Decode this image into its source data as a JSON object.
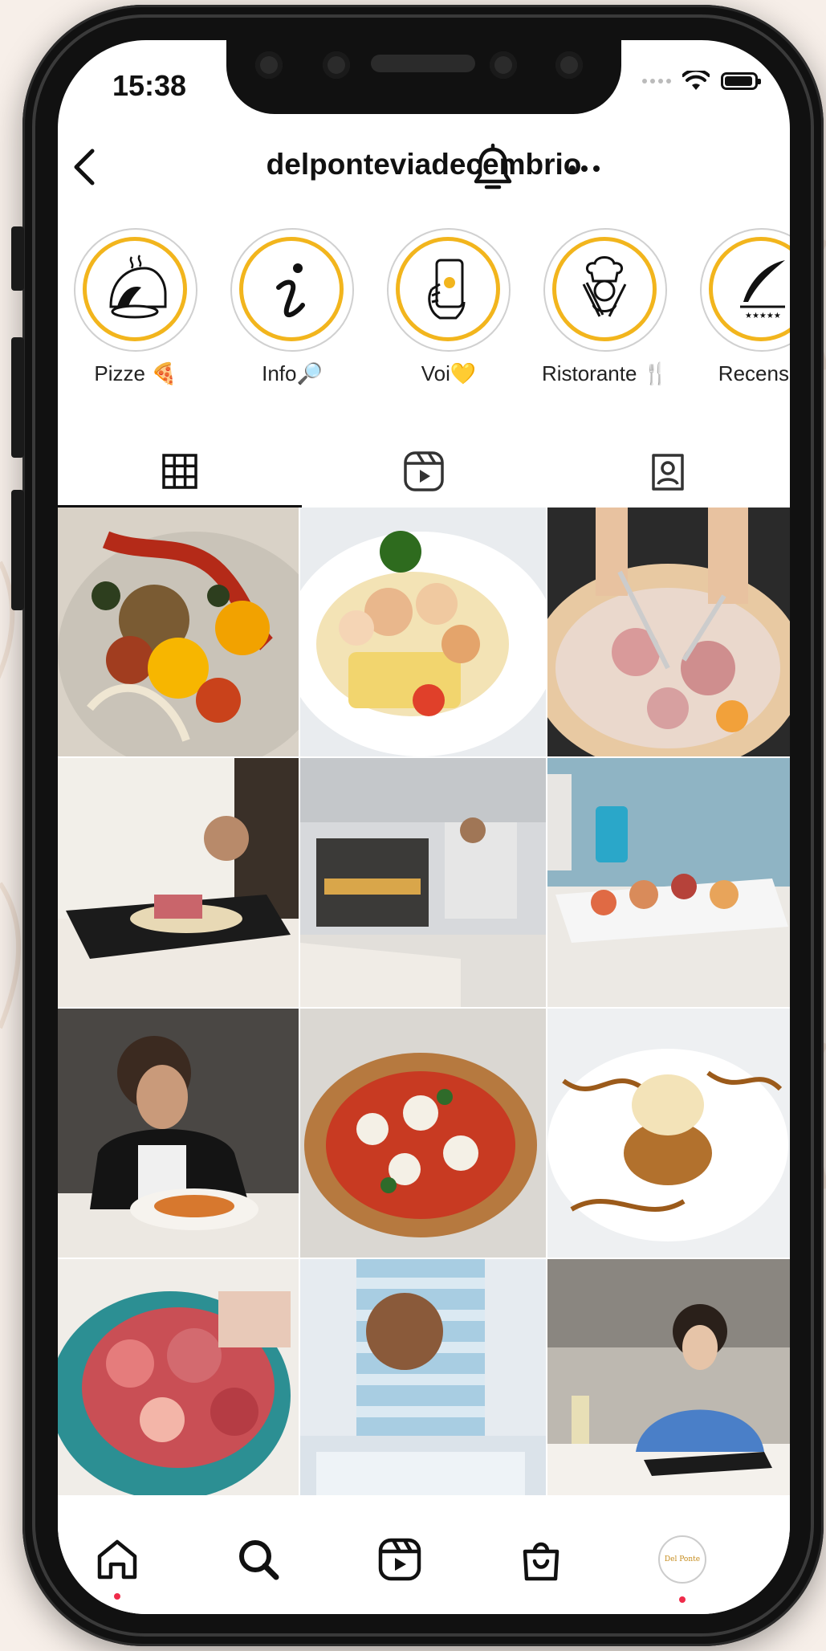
{
  "status_bar": {
    "time": "15:38"
  },
  "header": {
    "username": "delponteviadecembrio"
  },
  "highlights": [
    {
      "label": "Pizze 🍕",
      "icon": "pizza-oven-icon"
    },
    {
      "label": "Info🔎",
      "icon": "info-icon"
    },
    {
      "label": "Voi💛",
      "icon": "phone-hand-icon"
    },
    {
      "label": "Ristorante 🍴",
      "icon": "chef-icon"
    },
    {
      "label": "Recensio",
      "icon": "quill-icon"
    }
  ],
  "tabs": [
    {
      "name": "posts-grid",
      "icon": "grid-icon",
      "active": true
    },
    {
      "name": "reels",
      "icon": "reels-icon",
      "active": false
    },
    {
      "name": "tagged",
      "icon": "tagged-icon",
      "active": false
    }
  ],
  "posts": [
    {
      "subject": "lobster salad with orange"
    },
    {
      "subject": "seafood on potato with tomato"
    },
    {
      "subject": "prosciutto pizza being cut"
    },
    {
      "subject": "steak being sliced"
    },
    {
      "subject": "pizzaiolo at oven"
    },
    {
      "subject": "fish plate with white wine"
    },
    {
      "subject": "woman eating pasta"
    },
    {
      "subject": "margherita pizza"
    },
    {
      "subject": "dessert with gelato"
    },
    {
      "subject": "cured meats platter"
    },
    {
      "subject": "restaurant interior"
    },
    {
      "subject": "woman eating fish"
    }
  ],
  "bottom_nav": {
    "items": [
      "home",
      "search",
      "reels",
      "shop",
      "profile"
    ]
  },
  "avatar_text": "Del Ponte",
  "colors": {
    "highlight_ring": "#f2b51d",
    "notification_dot": "#ef2b4a"
  }
}
